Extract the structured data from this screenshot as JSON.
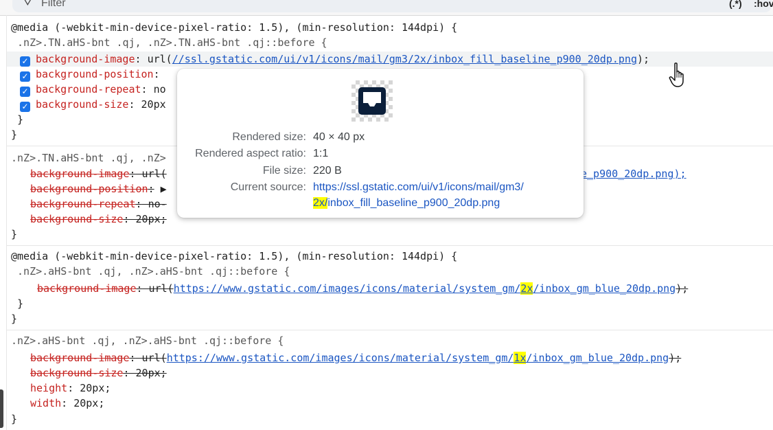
{
  "filter": {
    "placeholder": "Filter",
    "regex_toggle": "(.*)",
    "hov_toggle": ":hov"
  },
  "rules": [
    {
      "media_keyword": "@media",
      "media_query": " (-webkit-min-device-pixel-ratio: 1.5), (min-resolution: 144dpi) {",
      "selector": " .nZ>.TN.aHS-bnt .qj, .nZ>.TN.aHS-bnt .qj::before {",
      "declarations": [
        {
          "prop": "background-image",
          "pre": "url(",
          "url": "//ssl.gstatic.com/ui/v1/icons/mail/gm3/2x/inbox_fill_baseline_p900_20dp.png",
          "post": ");"
        },
        {
          "prop": "background-position",
          "value": ""
        },
        {
          "prop": "background-repeat",
          "value": " no"
        },
        {
          "prop": "background-size",
          "value": " 20px"
        }
      ],
      "inner_close": " }",
      "outer_close": "}"
    },
    {
      "selector": ".nZ>.TN.aHS-bnt .qj, .nZ>",
      "declarations": [
        {
          "prop": "background-image",
          "value": " url(",
          "tail": "e_p900_20dp.png);"
        },
        {
          "prop": "background-position",
          "value": " ▶"
        },
        {
          "prop": "background-repeat",
          "value": " no-"
        },
        {
          "prop": "background-size",
          "value": " 20px;"
        }
      ],
      "close": "}"
    },
    {
      "media_keyword": "@media",
      "media_query": " (-webkit-min-device-pixel-ratio: 1.5), (min-resolution: 144dpi) {",
      "selector": " .nZ>.aHS-bnt .qj, .nZ>.aHS-bnt .qj::before {",
      "declaration": {
        "prop": "background-image",
        "pre": " url(",
        "url_a": "https://www.gstatic.com/images/icons/material/system_gm/",
        "url_hl": "2x",
        "url_b": "/inbox_gm_blue_20dp.png",
        "post": ");"
      },
      "inner_close": " }",
      "outer_close": "}"
    },
    {
      "selector": ".nZ>.aHS-bnt .qj, .nZ>.aHS-bnt .qj::before {",
      "decl_image": {
        "prop": "background-image",
        "pre": " url(",
        "url_a": "https://www.gstatic.com/images/icons/material/system_gm/",
        "url_hl": "1x",
        "url_b": "/inbox_gm_blue_20dp.png",
        "post": ");"
      },
      "decl_size": {
        "prop": "background-size",
        "value": " 20px;"
      },
      "decl_height": {
        "prop": "height",
        "value": " 20px;"
      },
      "decl_width": {
        "prop": "width",
        "value": " 20px;"
      },
      "close": "}"
    }
  ],
  "tooltip": {
    "rendered_size_label": "Rendered size:",
    "rendered_size_value": "40 × 40 px",
    "aspect_label": "Rendered aspect ratio:",
    "aspect_value": "1:1",
    "filesize_label": "File size:",
    "filesize_value": "220 B",
    "source_label": "Current source:",
    "source_line1": "https://ssl.gstatic.com/ui/v1/icons/mail/gm3/",
    "source_hl": "2x/",
    "source_line2": "inbox_fill_baseline_p900_20dp.png"
  },
  "colors": {
    "property": "#c5221f",
    "link": "#1a55c2",
    "highlight": "#ffff00",
    "checkbox": "#1a73e8",
    "inbox_icon": "#0b1f3a"
  },
  "icons": [
    "filter-icon",
    "checkbox-checked-icon",
    "hand-pointer-icon",
    "inbox-icon"
  ]
}
